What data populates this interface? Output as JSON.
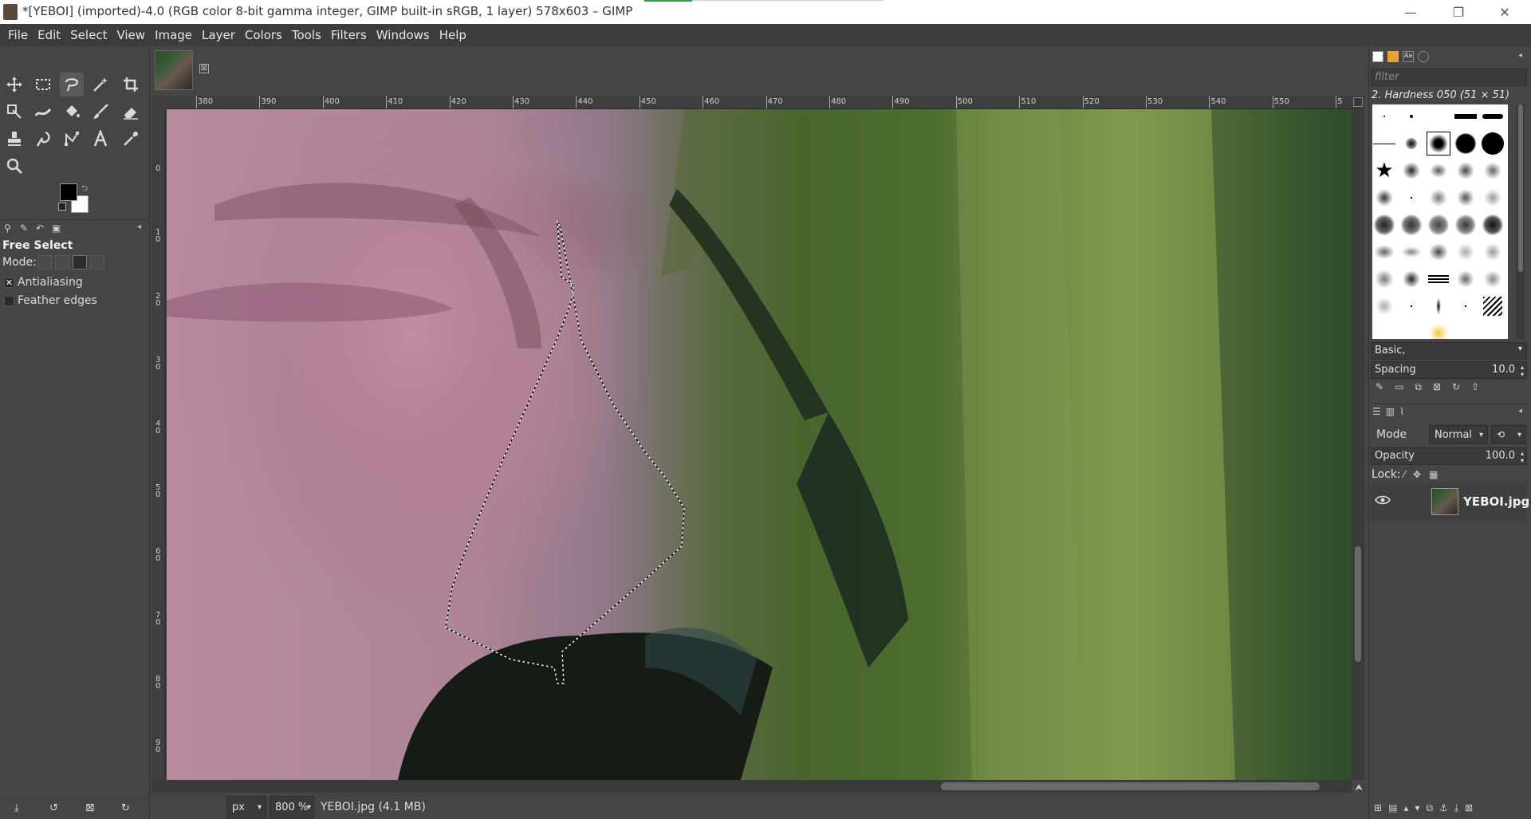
{
  "window": {
    "title": "*[YEBOI] (imported)-4.0 (RGB color 8-bit gamma integer, GIMP built-in sRGB, 1 layer) 578x603 – GIMP",
    "minimize": "—",
    "restore": "❐",
    "close": "✕"
  },
  "menubar": [
    "File",
    "Edit",
    "Select",
    "View",
    "Image",
    "Layer",
    "Colors",
    "Tools",
    "Filters",
    "Windows",
    "Help"
  ],
  "tool_options": {
    "title": "Free Select",
    "mode_label": "Mode:",
    "antialiasing_label": "Antialiasing",
    "antialiasing_checked": "✕",
    "feather_label": "Feather edges"
  },
  "image_tab": {
    "close": "⊠"
  },
  "ruler": {
    "h_ticks": [
      "380",
      "390",
      "400",
      "410",
      "420",
      "430",
      "440",
      "450",
      "460",
      "470",
      "480",
      "490",
      "500",
      "510",
      "520",
      "530",
      "540",
      "550",
      "5"
    ],
    "v_ticks": [
      "0",
      "1\n0",
      "2\n0",
      "3\n0",
      "4\n0",
      "5\n0",
      "6\n0",
      "7\n0",
      "8\n0",
      "9\n0"
    ]
  },
  "statusbar": {
    "unit": "px",
    "zoom": "800 %",
    "file_info": "YEBOI.jpg (4.1 MB)"
  },
  "brushes": {
    "filter_placeholder": "filter",
    "selected_name": "2. Hardness 050 (51 × 51)",
    "tag_combo": "Basic,",
    "spacing_label": "Spacing",
    "spacing_value": "10.0"
  },
  "layers": {
    "mode_label": "Mode",
    "mode_value": "Normal",
    "opacity_label": "Opacity",
    "opacity_value": "100.0",
    "lock_label": "Lock:",
    "layer_name": "YEBOI.jpg"
  },
  "colors": {
    "foreground": "#000000",
    "background": "#ffffff"
  }
}
